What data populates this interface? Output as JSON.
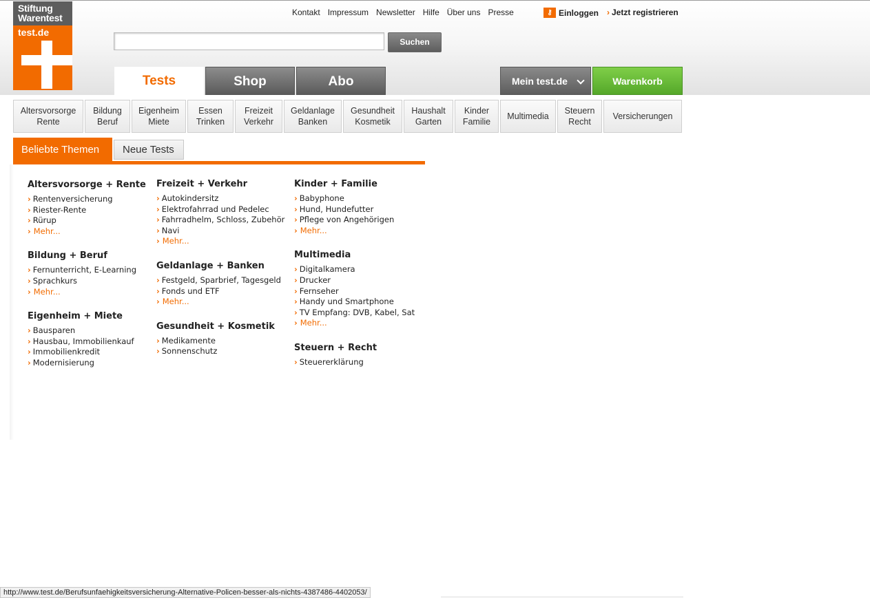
{
  "logo": {
    "line1": "Stiftung",
    "line2": "Warentest",
    "domain": "test.de"
  },
  "topnav": [
    "Kontakt",
    "Impressum",
    "Newsletter",
    "Hilfe",
    "Über uns",
    "Presse"
  ],
  "account": {
    "login": "Einloggen",
    "register": "Jetzt registrieren"
  },
  "search": {
    "value": "",
    "button": "Suchen"
  },
  "maintabs": {
    "tests": "Tests",
    "shop": "Shop",
    "abo": "Abo",
    "mein": "Mein test.de",
    "warenkorb": "Warenkorb"
  },
  "categories": [
    {
      "l1": "Altersvorsorge",
      "l2": "Rente"
    },
    {
      "l1": "Bildung",
      "l2": "Beruf"
    },
    {
      "l1": "Eigenheim",
      "l2": "Miete"
    },
    {
      "l1": "Essen",
      "l2": "Trinken"
    },
    {
      "l1": "Freizeit",
      "l2": "Verkehr"
    },
    {
      "l1": "Geldanlage",
      "l2": "Banken"
    },
    {
      "l1": "Gesundheit",
      "l2": "Kosmetik"
    },
    {
      "l1": "Haushalt",
      "l2": "Garten"
    },
    {
      "l1": "Kinder",
      "l2": "Familie"
    },
    {
      "l1": "Multimedia",
      "l2": ""
    },
    {
      "l1": "Steuern",
      "l2": "Recht"
    },
    {
      "l1": "Versicherungen",
      "l2": ""
    }
  ],
  "themetabs": {
    "active": "Beliebte Themen",
    "other": "Neue Tests"
  },
  "columns": [
    [
      {
        "title": "Altersvorsorge + Rente",
        "links": [
          "Rentenversicherung",
          "Riester-Rente",
          "Rürup"
        ],
        "more": "Mehr..."
      },
      {
        "title": "Bildung + Beruf",
        "links": [
          "Fernunterricht, E-Learning",
          "Sprachkurs"
        ],
        "more": "Mehr..."
      },
      {
        "title": "Eigenheim + Miete",
        "links": [
          "Bausparen",
          "Hausbau, Immobilienkauf",
          "Immobilienkredit",
          "Modernisierung"
        ],
        "more": ""
      }
    ],
    [
      {
        "title": "Freizeit + Verkehr",
        "links": [
          "Autokindersitz",
          "Elektrofahrrad und Pedelec",
          "Fahrradhelm, Schloss, Zubehör",
          "Navi"
        ],
        "more": "Mehr..."
      },
      {
        "title": "Geldanlage + Banken",
        "links": [
          "Festgeld, Sparbrief, Tagesgeld",
          "Fonds und ETF"
        ],
        "more": "Mehr..."
      },
      {
        "title": "Gesundheit + Kosmetik",
        "links": [
          "Medikamente",
          "Sonnenschutz"
        ],
        "more": ""
      }
    ],
    [
      {
        "title": "Kinder + Familie",
        "links": [
          "Babyphone",
          "Hund, Hundefutter",
          "Pflege von Angehörigen"
        ],
        "more": "Mehr..."
      },
      {
        "title": "Multimedia",
        "links": [
          "Digitalkamera",
          "Drucker",
          "Fernseher",
          "Handy und Smartphone",
          "TV Empfang: DVB, Kabel, Sat"
        ],
        "more": "Mehr..."
      },
      {
        "title": "Steuern + Recht",
        "links": [
          "Steuererklärung"
        ],
        "more": ""
      }
    ]
  ],
  "statusbar": "http://www.test.de/Berufsunfaehigkeitsversicherung-Alternative-Policen-besser-als-nichts-4387486-4402053/",
  "colors": {
    "accent": "#f26b00",
    "green": "#5cb030",
    "gray": "#6b6b6b"
  }
}
